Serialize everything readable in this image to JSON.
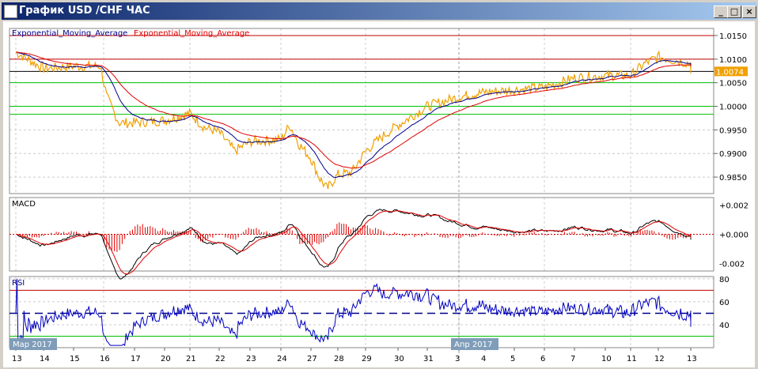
{
  "window": {
    "title": "График USD /CHF  ЧАС",
    "minimize": "_",
    "maximize": "□",
    "close": "×"
  },
  "price_pane": {
    "legend_1": "Exponential_Moving_Average",
    "legend_2": "Exponential_Moving_Average",
    "current_price": "1.0074",
    "y_ticks": [
      "1.0150",
      "1.0100",
      "1.0050",
      "1.0000",
      "0.9950",
      "0.9900",
      "0.9850"
    ]
  },
  "macd_pane": {
    "title": "MACD",
    "y_ticks": [
      "+0.002",
      "+0.000",
      "-0.002"
    ]
  },
  "rsi_pane": {
    "title": "RSI",
    "y_ticks": [
      "80",
      "60",
      "40"
    ]
  },
  "x_axis": {
    "days": [
      "13",
      "14",
      "15",
      "16",
      "17",
      "20",
      "21",
      "22",
      "23",
      "24",
      "27",
      "28",
      "29",
      "30",
      "31",
      "3",
      "4",
      "5",
      "6",
      "7",
      "10",
      "11",
      "12",
      "13"
    ],
    "month_labels": [
      "Мар 2017",
      "Апр 2017"
    ]
  },
  "colors": {
    "price": "#f0a000",
    "ema_fast": "#00008b",
    "ema_slow": "#e00000",
    "macd_hist": "#e00000",
    "rsi": "#0000c0",
    "level_red": "#c00000",
    "level_green": "#00c000"
  },
  "chart_data": {
    "type": "line",
    "title": "USD/CHF H1",
    "price_keypoints": [
      [
        0,
        1.0115
      ],
      [
        1,
        1.008
      ],
      [
        2,
        1.0085
      ],
      [
        2.9,
        1.0085
      ],
      [
        3.1,
        1.002
      ],
      [
        3.5,
        0.9965
      ],
      [
        4,
        0.9965
      ],
      [
        5,
        0.997
      ],
      [
        6,
        0.9985
      ],
      [
        6.5,
        0.9955
      ],
      [
        7,
        0.9945
      ],
      [
        7.5,
        0.9905
      ],
      [
        8,
        0.9925
      ],
      [
        9,
        0.993
      ],
      [
        9.3,
        0.996
      ],
      [
        9.6,
        0.992
      ],
      [
        10,
        0.989
      ],
      [
        10.3,
        0.985
      ],
      [
        10.6,
        0.9825
      ],
      [
        11,
        0.9855
      ],
      [
        11.5,
        0.986
      ],
      [
        12,
        0.9905
      ],
      [
        12.5,
        0.9935
      ],
      [
        13,
        0.996
      ],
      [
        14,
        1.0
      ],
      [
        15,
        1.002
      ],
      [
        16,
        1.003
      ],
      [
        17,
        1.0035
      ],
      [
        18,
        1.004
      ],
      [
        19,
        1.006
      ],
      [
        20,
        1.0065
      ],
      [
        21,
        1.0065
      ],
      [
        21.5,
        1.009
      ],
      [
        22,
        1.0105
      ],
      [
        23,
        1.009
      ],
      [
        23.4,
        1.0074
      ]
    ],
    "price_levels": {
      "red": [
        1.015,
        1.01
      ],
      "black": [
        1.0074
      ],
      "green": [
        1.005,
        1.0,
        0.9983
      ]
    },
    "price_ylim": [
      0.9815,
      1.0165
    ],
    "macd_ylim": [
      -0.0025,
      0.0025
    ],
    "rsi_levels": [
      70,
      50,
      30
    ],
    "rsi_ylim": [
      20,
      82
    ]
  }
}
